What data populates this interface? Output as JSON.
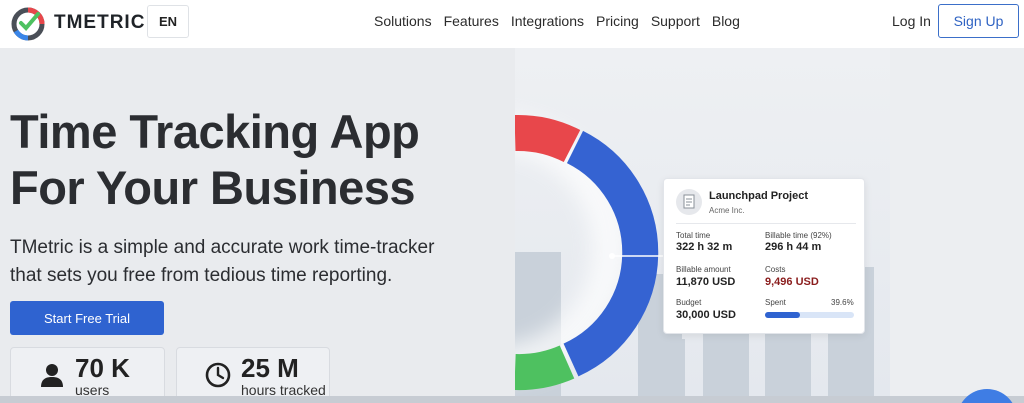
{
  "header": {
    "brand": "TMETRIC",
    "lang": "EN",
    "nav": [
      "Solutions",
      "Features",
      "Integrations",
      "Pricing",
      "Support",
      "Blog"
    ],
    "login": "Log In",
    "signup": "Sign Up"
  },
  "hero": {
    "title_line1": "Time Tracking App",
    "title_line2": "For Your Business",
    "subtitle_line1": "TMetric is a simple and accurate work time-tracker",
    "subtitle_line2": "that sets you free from tedious time reporting.",
    "cta": "Start Free Trial"
  },
  "stats": [
    {
      "value": "70 K",
      "label": "users",
      "icon": "user-icon"
    },
    {
      "value": "25 M",
      "label": "hours tracked",
      "icon": "clock-icon"
    }
  ],
  "card": {
    "title": "Launchpad Project",
    "client": "Acme Inc.",
    "total_time_label": "Total time",
    "total_time": "322 h 32 m",
    "billable_time_label": "Billable time (92%)",
    "billable_time": "296 h 44 m",
    "billable_amount_label": "Billable amount",
    "billable_amount": "11,870 USD",
    "costs_label": "Costs",
    "costs": "9,496 USD",
    "budget_label": "Budget",
    "budget": "30,000 USD",
    "spent_label": "Spent",
    "spent_pct": "39.6%",
    "spent_fraction": 0.396
  },
  "colors": {
    "brand_blue": "#2f63d0",
    "donut_blue": "#3563d2",
    "donut_red": "#e8474b",
    "donut_green": "#4ec160",
    "cost_red": "#8a1c1c"
  }
}
